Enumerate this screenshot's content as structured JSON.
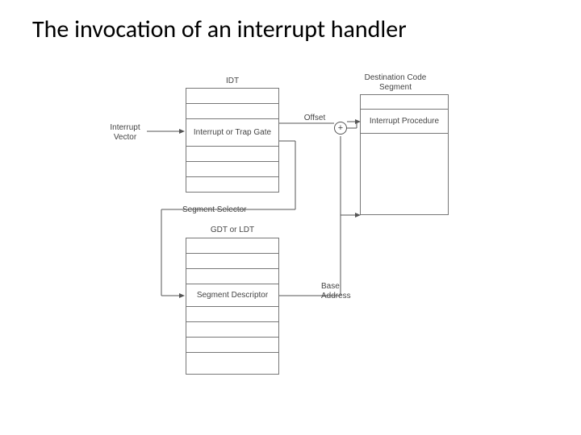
{
  "title": "The invocation of an interrupt handler",
  "labels": {
    "idt": "IDT",
    "interrupt_vector": "Interrupt Vector",
    "gate": "Interrupt or Trap Gate",
    "offset": "Offset",
    "segment_selector": "Segment Selector",
    "gdt_ldt": "GDT or LDT",
    "segment_descriptor": "Segment Descriptor",
    "base_address": "Base Address",
    "dest_code_segment": "Destination Code Segment",
    "interrupt_procedure": "Interrupt Procedure",
    "plus": "+"
  }
}
